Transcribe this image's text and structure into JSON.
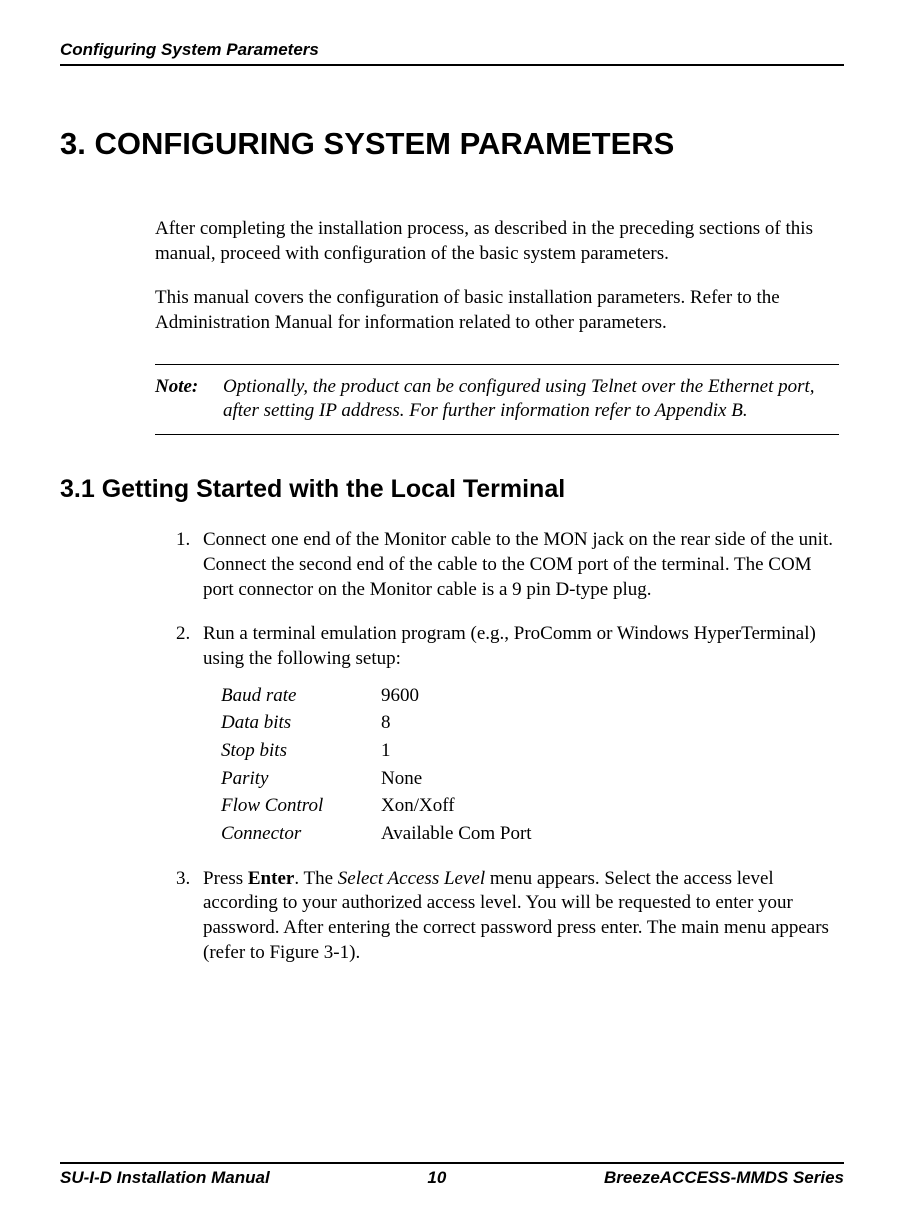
{
  "header": {
    "running_title": "Configuring System Parameters"
  },
  "chapter": {
    "number_and_title": "3. CONFIGURING SYSTEM PARAMETERS"
  },
  "intro": {
    "p1": "After completing the installation process, as described in the preceding sections of this manual, proceed with configuration of the basic system parameters.",
    "p2": "This manual covers the configuration of basic installation parameters. Refer to the Administration Manual for information related to other parameters."
  },
  "note": {
    "label": "Note:",
    "text": "Optionally, the product can be configured using Telnet over the Ethernet port, after setting IP address. For further information refer to Appendix B."
  },
  "section": {
    "number_and_title": "3.1  Getting Started with the Local Terminal"
  },
  "steps": {
    "s1": "Connect one end of the Monitor cable to the MON jack on the rear side of the unit. Connect the second end of the cable to the COM port of the terminal. The COM port connector on the Monitor cable is a 9 pin D-type plug.",
    "s2": "Run a terminal emulation program (e.g., ProComm or Windows HyperTerminal) using the following setup:",
    "setup": {
      "baud_label": "Baud rate",
      "baud_value": "9600",
      "data_label": "Data bits",
      "data_value": "8",
      "stop_label": "Stop bits",
      "stop_value": "1",
      "parity_label": "Parity",
      "parity_value": "None",
      "flow_label": "Flow Control",
      "flow_value": "Xon/Xoff",
      "conn_label": "Connector",
      "conn_value": "Available Com Port"
    },
    "s3_pre": "Press ",
    "s3_enter": "Enter",
    "s3_mid1": ". The ",
    "s3_menu": "Select Access Level",
    "s3_post": " menu appears. Select the access level according to your authorized access level. You will be requested to enter your password. After entering the correct password press enter. The main menu appears (refer to Figure 3-1)."
  },
  "footer": {
    "left": "SU-I-D Installation Manual",
    "center": "10",
    "right": "BreezeACCESS-MMDS Series"
  }
}
